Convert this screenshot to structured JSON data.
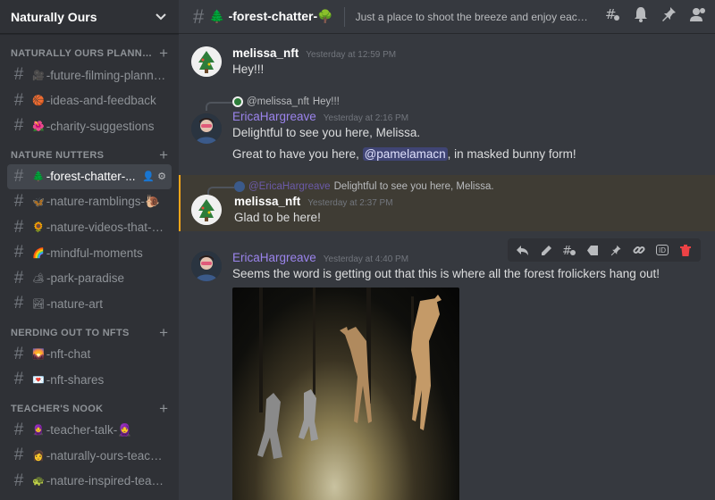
{
  "server": {
    "name": "Naturally Ours"
  },
  "categories": [
    {
      "label": "NATURALLY OURS PLANNING ...",
      "channels": [
        {
          "icon": "🎥",
          "name": "-future-filming-planning"
        },
        {
          "icon": "🏀",
          "name": "-ideas-and-feedback"
        },
        {
          "icon": "🌺",
          "name": "-charity-suggestions"
        }
      ]
    },
    {
      "label": "NATURE NUTTERS",
      "channels": [
        {
          "icon": "🌲",
          "name": "-forest-chatter-...",
          "active": true
        },
        {
          "icon": "🦋",
          "name": "-nature-ramblings-🐌"
        },
        {
          "icon": "🌻",
          "name": "-nature-videos-that-y..."
        },
        {
          "icon": "🌈",
          "name": "-mindful-moments"
        },
        {
          "icon": "🏕",
          "name": "-park-paradise"
        },
        {
          "icon": "🏞",
          "name": "-nature-art"
        }
      ]
    },
    {
      "label": "NERDING OUT TO NFTS",
      "channels": [
        {
          "icon": "🌄",
          "name": "-nft-chat"
        },
        {
          "icon": "💌",
          "name": "-nft-shares"
        }
      ]
    },
    {
      "label": "TEACHER'S NOOK",
      "channels": [
        {
          "icon": "🧕",
          "name": "-teacher-talk-🧕"
        },
        {
          "icon": "👩",
          "name": "-naturally-ours-teachi..."
        },
        {
          "icon": "🐢",
          "name": "-nature-inspired-teac..."
        }
      ]
    }
  ],
  "topbar": {
    "channel_title": "🌲 -forest-chatter-🌳",
    "topic": "Just a place to shoot the breeze and enjoy each other's company!"
  },
  "messages": [
    {
      "author": "melissa_nft",
      "timestamp": "Yesterday at 12:59 PM",
      "lines": [
        "Hey!!!"
      ]
    },
    {
      "reply_to": {
        "author": "@melissa_nft",
        "text": "Hey!!!"
      },
      "author": "EricaHargreave",
      "timestamp": "Yesterday at 2:16 PM",
      "lines": [
        "Delightful to see you here, Melissa."
      ],
      "line2_pre": "Great to have you here, ",
      "line2_mention": "@pamelamacn",
      "line2_post": ", in masked bunny form!"
    },
    {
      "reply_to": {
        "author": "@EricaHargreave",
        "text": "Delightful to see you here, Melissa."
      },
      "author": "melissa_nft",
      "timestamp": "Yesterday at 2:37 PM",
      "lines": [
        "Glad to be here!"
      ]
    },
    {
      "author": "EricaHargreave",
      "timestamp": "Yesterday at 4:40 PM",
      "lines": [
        "Seems the word is getting out that this is where all the forest frolickers hang out!"
      ],
      "hover_id_label": "ID"
    }
  ],
  "colors": {
    "accent": "#5865f2",
    "erica": "#9b84ec",
    "highlight_border": "#faa61a",
    "delete": "#ed4245"
  }
}
